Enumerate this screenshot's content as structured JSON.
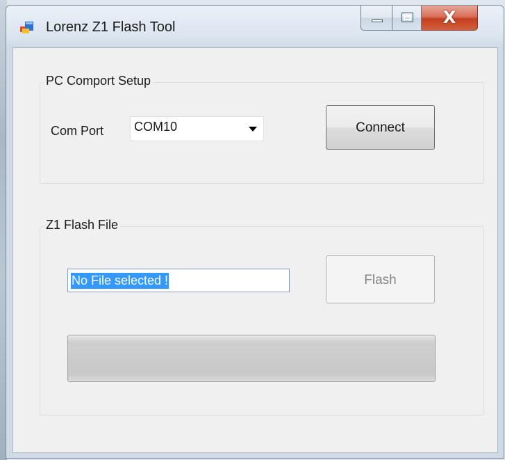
{
  "window": {
    "title": "Lorenz Z1 Flash Tool",
    "caption_buttons": {
      "minimize": "minimize-icon",
      "maximize": "maximize-icon",
      "close": "X"
    }
  },
  "comport_group": {
    "title": "PC Comport Setup",
    "com_port_label": "Com Port",
    "com_port_value": "COM10",
    "connect_label": "Connect"
  },
  "flash_group": {
    "title": "Z1 Flash File",
    "file_value": "No File selected !",
    "flash_label": "Flash",
    "flash_enabled": false,
    "progress": 0
  },
  "colors": {
    "selection_highlight": "#3399ff",
    "close_button": "#c4401f",
    "client_background": "#f0f0f0"
  }
}
